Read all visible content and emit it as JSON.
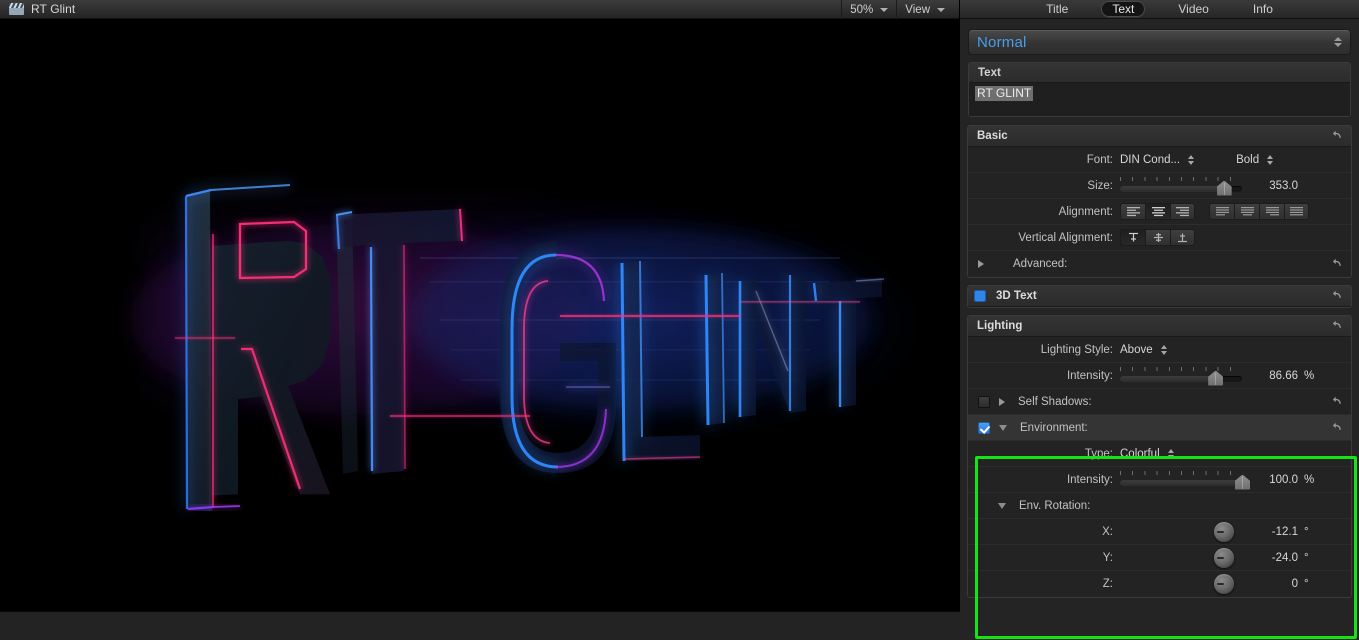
{
  "viewer": {
    "title": "RT Glint",
    "icon": "clapperboard-icon",
    "zoom_label": "50%",
    "view_label": "View",
    "artwork_text": "RT GLINT",
    "artwork_description": "3D extruded neon text reading RT GLINT in perspective on black background"
  },
  "inspector": {
    "tabs": [
      {
        "label": "Title",
        "active": false
      },
      {
        "label": "Text",
        "active": true
      },
      {
        "label": "Video",
        "active": false
      },
      {
        "label": "Info",
        "active": false
      }
    ],
    "style_popup": {
      "value": "Normal"
    },
    "text_panel": {
      "header": "Text",
      "value": "RT GLINT"
    },
    "basic": {
      "header": "Basic",
      "font_label": "Font:",
      "font_value": "DIN Cond...",
      "font_weight": "Bold",
      "size_label": "Size:",
      "size_value": "353.0",
      "size_pct": 85,
      "alignment_label": "Alignment:",
      "alignment_selected_index": 1,
      "justify_selected_index": -1,
      "vertical_alignment_label": "Vertical Alignment:",
      "vertical_selected_index": 0,
      "advanced_label": "Advanced:"
    },
    "three_d_text": {
      "header": "3D Text",
      "enabled": true
    },
    "lighting": {
      "header": "Lighting",
      "style_label": "Lighting Style:",
      "style_value": "Above",
      "intensity_label": "Intensity:",
      "intensity_value": "86.66",
      "intensity_unit": "%",
      "intensity_pct": 78,
      "self_shadows_label": "Self Shadows:",
      "self_shadows_enabled": false,
      "environment_label": "Environment:",
      "environment_enabled": true,
      "environment": {
        "type_label": "Type:",
        "type_value": "Colorful",
        "intensity_label": "Intensity:",
        "intensity_value": "100.0",
        "intensity_unit": "%",
        "intensity_pct": 100,
        "rotation_label": "Env. Rotation:",
        "rotation": [
          {
            "axis": "X:",
            "value": "-12.1",
            "unit": "°"
          },
          {
            "axis": "Y:",
            "value": "-24.0",
            "unit": "°"
          },
          {
            "axis": "Z:",
            "value": "0",
            "unit": "°"
          }
        ]
      }
    },
    "highlight_color": "#16e316",
    "accent_color": "#4a9eea"
  }
}
